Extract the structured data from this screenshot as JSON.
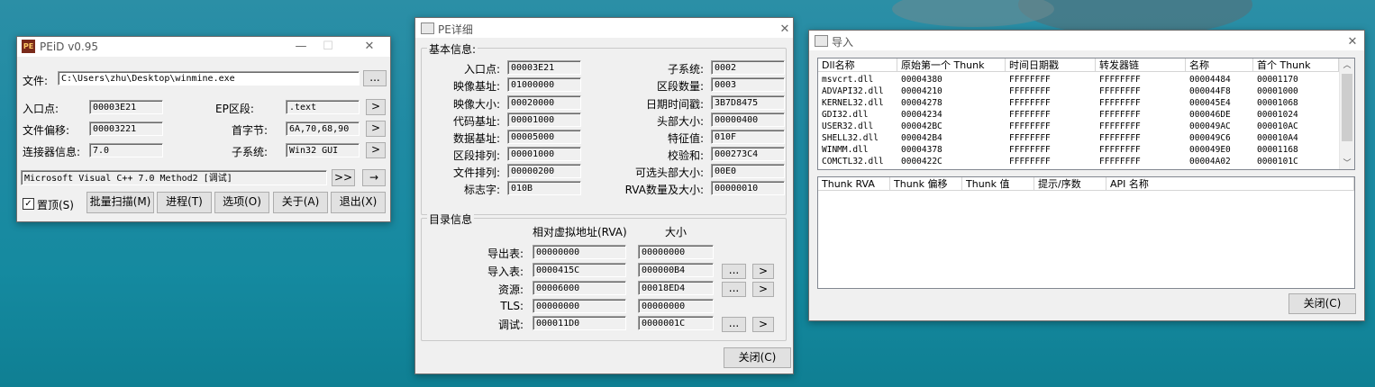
{
  "peid": {
    "title": "PEiD v0.95",
    "file_label": "文件:",
    "file_path": "C:\\Users\\zhu\\Desktop\\winmine.exe",
    "browse": "...",
    "entry_label": "入口点:",
    "entry_value": "00003E21",
    "ep_section_label": "EP区段:",
    "ep_section_value": ".text",
    "file_offset_label": "文件偏移:",
    "file_offset_value": "00003221",
    "first_bytes_label": "首字节:",
    "first_bytes_value": "6A,70,68,90",
    "linker_label": "连接器信息:",
    "linker_value": "7.0",
    "subsystem_label": "子系统:",
    "subsystem_value": "Win32 GUI",
    "arrow": ">",
    "detect_result": "Microsoft Visual C++ 7.0 Method2 [调试]",
    "double_arrow": ">>",
    "right_arrow": "→",
    "ontop_label": "置顶(S)",
    "buttons": [
      "批量扫描(M)",
      "进程(T)",
      "选项(O)",
      "关于(A)",
      "退出(X)"
    ]
  },
  "pe": {
    "title": "PE详细",
    "basic_group": "基本信息:",
    "left_fields": [
      {
        "label": "入口点:",
        "value": "00003E21"
      },
      {
        "label": "映像基址:",
        "value": "01000000"
      },
      {
        "label": "映像大小:",
        "value": "00020000"
      },
      {
        "label": "代码基址:",
        "value": "00001000"
      },
      {
        "label": "数据基址:",
        "value": "00005000"
      },
      {
        "label": "区段排列:",
        "value": "00001000"
      },
      {
        "label": "文件排列:",
        "value": "00000200"
      },
      {
        "label": "标志字:",
        "value": "010B"
      }
    ],
    "right_fields": [
      {
        "label": "子系统:",
        "value": "0002"
      },
      {
        "label": "区段数量:",
        "value": "0003"
      },
      {
        "label": "日期时间戳:",
        "value": "3B7D8475"
      },
      {
        "label": "头部大小:",
        "value": "00000400"
      },
      {
        "label": "特征值:",
        "value": "010F"
      },
      {
        "label": "校验和:",
        "value": "000273C4"
      },
      {
        "label": "可选头部大小:",
        "value": "00E0"
      },
      {
        "label": "RVA数量及大小:",
        "value": "00000010"
      }
    ],
    "dir_group": "目录信息",
    "dir_col_rva": "相对虚拟地址(RVA)",
    "dir_col_size": "大小",
    "dirs": [
      {
        "label": "导出表:",
        "rva": "00000000",
        "size": "00000000",
        "buttons": false
      },
      {
        "label": "导入表:",
        "rva": "0000415C",
        "size": "000000B4",
        "buttons": true
      },
      {
        "label": "资源:",
        "rva": "00006000",
        "size": "00018ED4",
        "buttons": true
      },
      {
        "label": "TLS:",
        "rva": "00000000",
        "size": "00000000",
        "buttons": false
      },
      {
        "label": "调试:",
        "rva": "000011D0",
        "size": "0000001C",
        "buttons": true
      }
    ],
    "more": "...",
    "go": ">",
    "close": "关闭(C)"
  },
  "imports": {
    "title": "导入",
    "columns": [
      "Dll名称",
      "原始第一个 Thunk",
      "时间日期戳",
      "转发器链",
      "名称",
      "首个 Thunk"
    ],
    "rows": [
      [
        "msvcrt.dll",
        "00004380",
        "FFFFFFFF",
        "FFFFFFFF",
        "00004484",
        "00001170"
      ],
      [
        "ADVAPI32.dll",
        "00004210",
        "FFFFFFFF",
        "FFFFFFFF",
        "000044F8",
        "00001000"
      ],
      [
        "KERNEL32.dll",
        "00004278",
        "FFFFFFFF",
        "FFFFFFFF",
        "000045E4",
        "00001068"
      ],
      [
        "GDI32.dll",
        "00004234",
        "FFFFFFFF",
        "FFFFFFFF",
        "000046DE",
        "00001024"
      ],
      [
        "USER32.dll",
        "000042BC",
        "FFFFFFFF",
        "FFFFFFFF",
        "000049AC",
        "000010AC"
      ],
      [
        "SHELL32.dll",
        "000042B4",
        "FFFFFFFF",
        "FFFFFFFF",
        "000049C6",
        "000010A4"
      ],
      [
        "WINMM.dll",
        "00004378",
        "FFFFFFFF",
        "FFFFFFFF",
        "000049E0",
        "00001168"
      ],
      [
        "COMCTL32.dll",
        "0000422C",
        "FFFFFFFF",
        "FFFFFFFF",
        "00004A02",
        "0000101C"
      ]
    ],
    "thunk_columns": [
      "Thunk RVA",
      "Thunk 偏移",
      "Thunk 值",
      "提示/序数",
      "API 名称"
    ],
    "close": "关闭(C)"
  },
  "window_controls": {
    "minimize": "—",
    "maximize": "☐",
    "close": "✕"
  }
}
